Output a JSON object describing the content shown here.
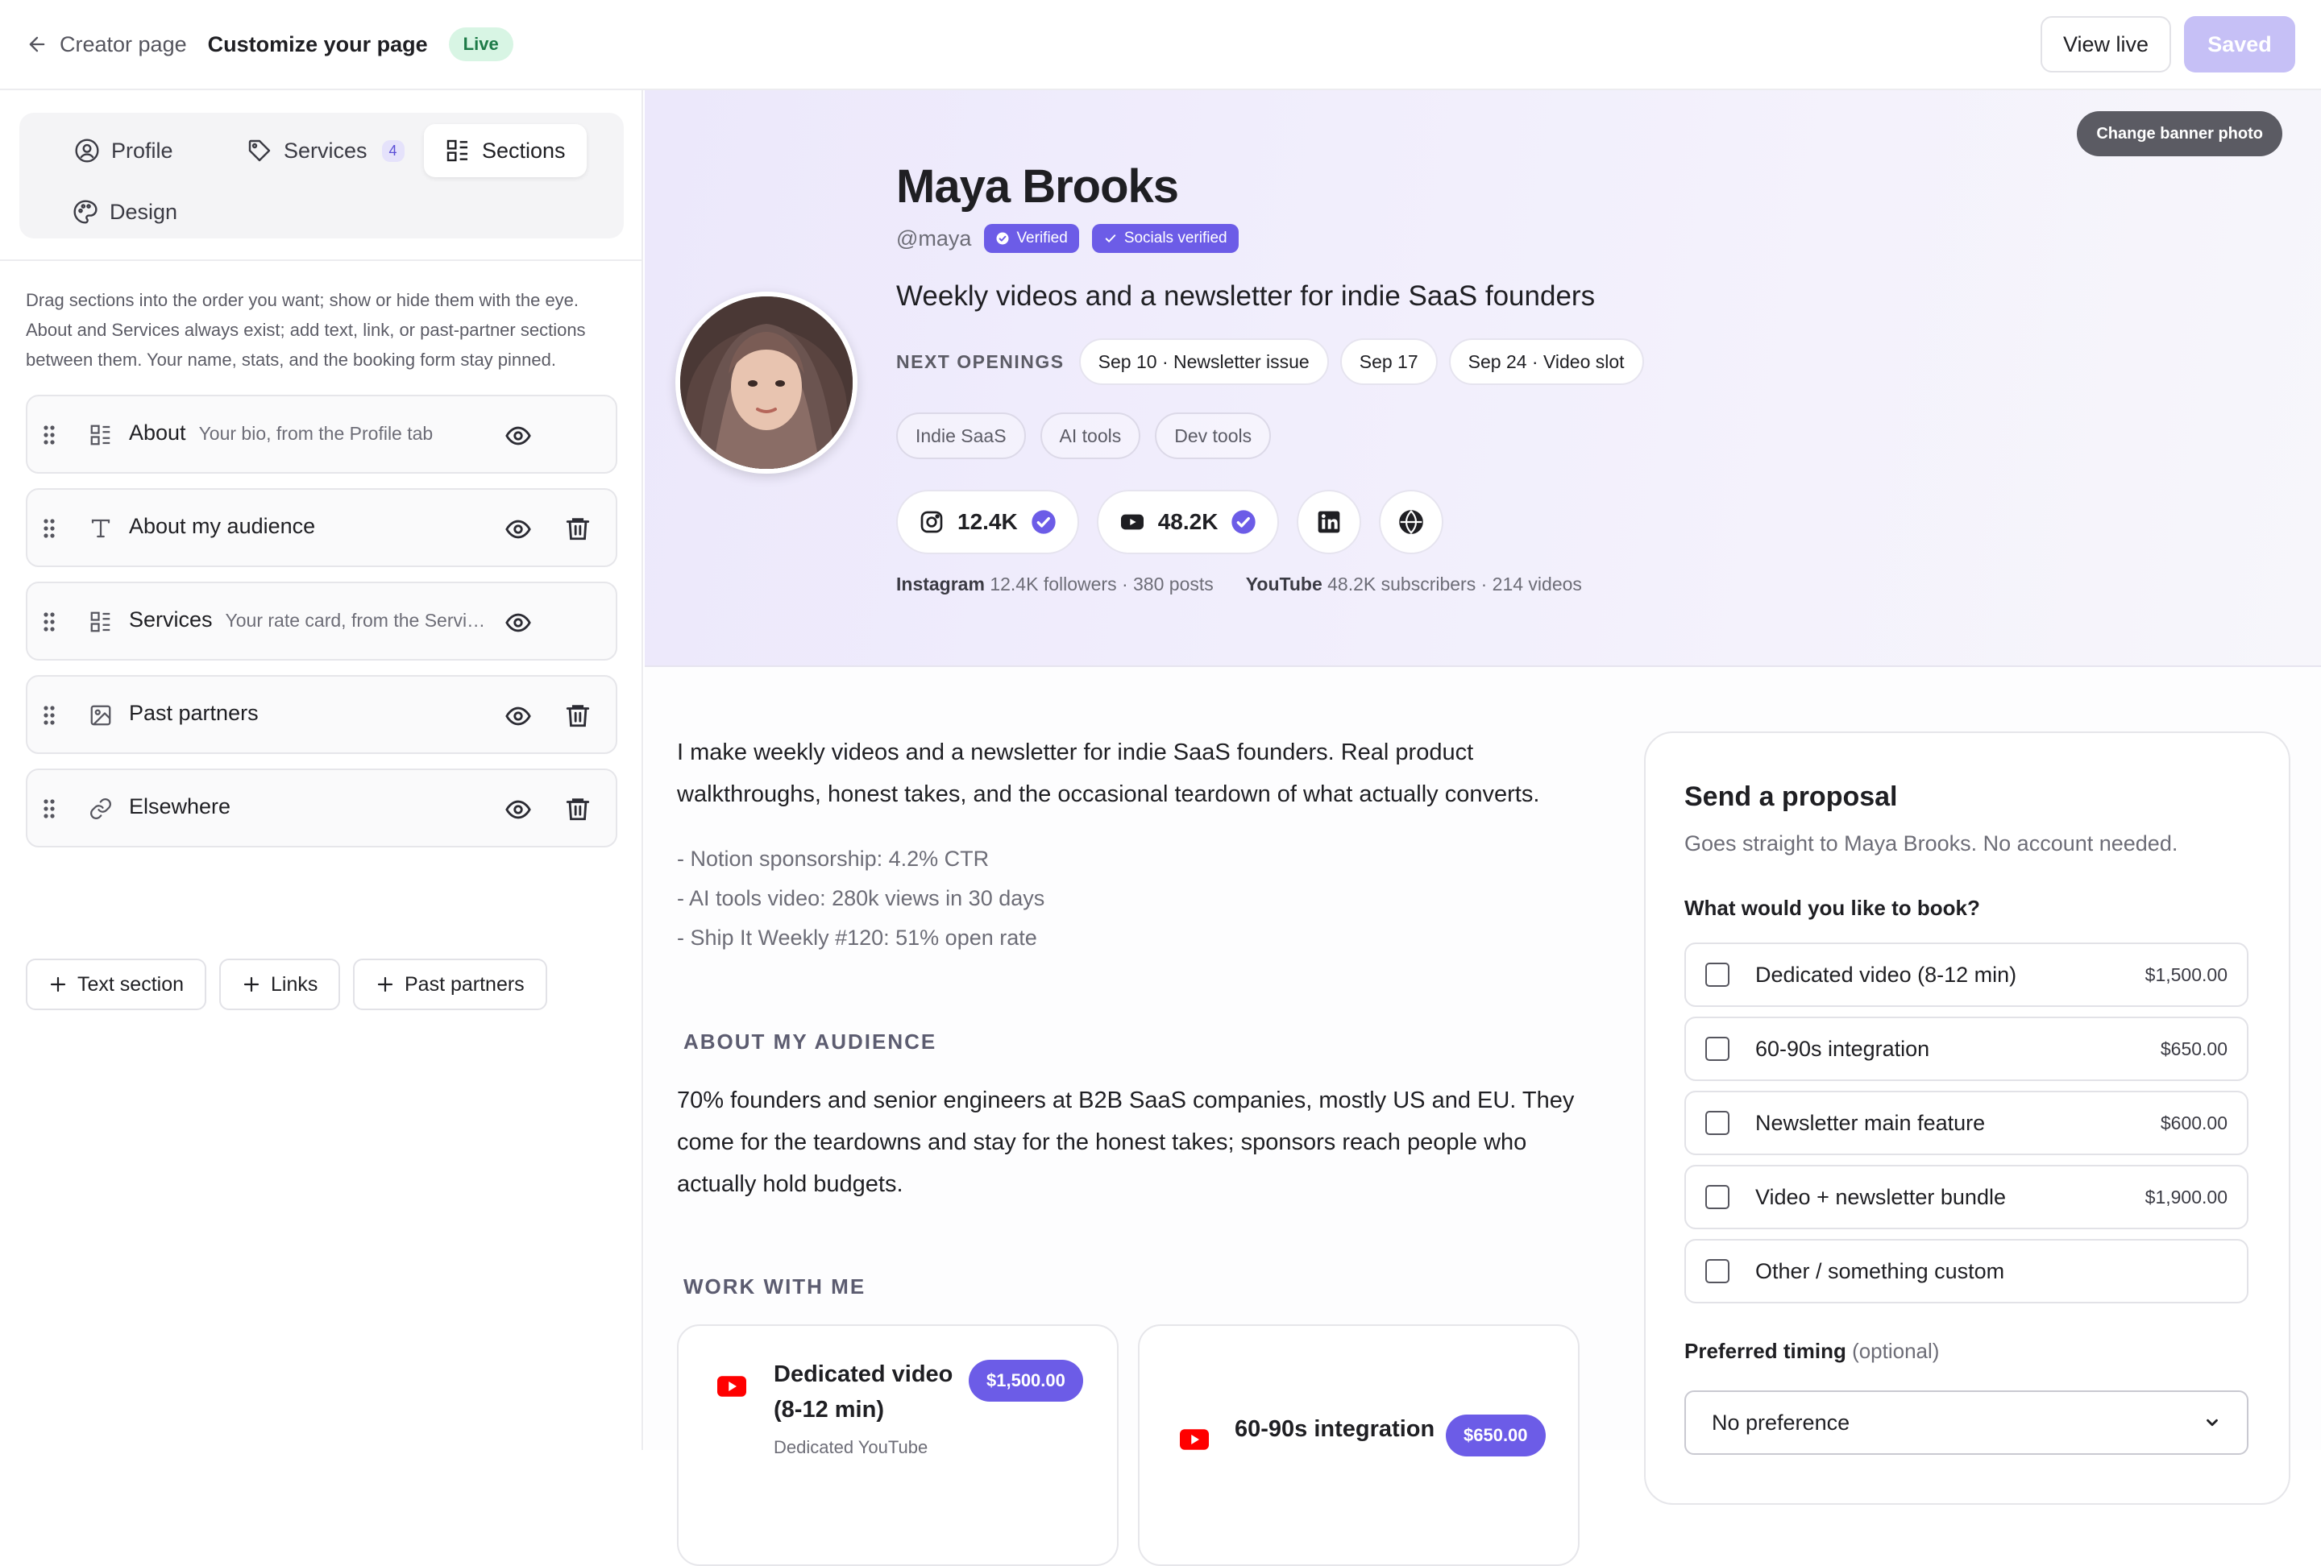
{
  "topbar": {
    "back_label": "Creator page",
    "title": "Customize your page",
    "status": "Live",
    "view_live": "View live",
    "saved": "Saved"
  },
  "sidebar": {
    "tabs": [
      {
        "label": "Profile",
        "icon": "user-circle-icon"
      },
      {
        "label": "Services",
        "icon": "tag-icon",
        "count": "4"
      },
      {
        "label": "Sections",
        "icon": "layout-list-icon",
        "active": true
      },
      {
        "label": "Design",
        "icon": "palette-icon"
      }
    ],
    "help_text": "Drag sections into the order you want; show or hide them with the eye. About and Services always exist; add text, link, or past-partner sections between them. Your name, stats, and the booking form stay pinned.",
    "sections": [
      {
        "title": "About",
        "sub": "Your bio, from the Profile tab",
        "icon": "layout-list-icon",
        "deletable": false
      },
      {
        "title": "About my audience",
        "sub": "",
        "icon": "text-icon",
        "deletable": true
      },
      {
        "title": "Services",
        "sub": "Your rate card, from the Servi…",
        "icon": "layout-list-icon",
        "deletable": false
      },
      {
        "title": "Past partners",
        "sub": "",
        "icon": "image-icon",
        "deletable": true
      },
      {
        "title": "Elsewhere",
        "sub": "",
        "icon": "link-icon",
        "deletable": true
      }
    ],
    "add_buttons": [
      "Text section",
      "Links",
      "Past partners"
    ]
  },
  "banner": {
    "change_banner": "Change banner photo",
    "name": "Maya Brooks",
    "handle": "@maya",
    "badges": [
      "Verified",
      "Socials verified"
    ],
    "tagline": "Weekly videos and a newsletter for indie SaaS founders",
    "openings_label": "NEXT OPENINGS",
    "openings": [
      "Sep 10 · Newsletter issue",
      "Sep 17",
      "Sep 24 · Video slot"
    ],
    "tags": [
      "Indie SaaS",
      "AI tools",
      "Dev tools"
    ],
    "socials": [
      {
        "platform": "instagram-icon",
        "count": "12.4K",
        "verified": true
      },
      {
        "platform": "youtube-icon",
        "count": "48.2K",
        "verified": true
      },
      {
        "platform": "linkedin-icon"
      },
      {
        "platform": "globe-icon"
      }
    ],
    "stats": [
      {
        "platform": "Instagram",
        "detail": "12.4K followers · 380 posts"
      },
      {
        "platform": "YouTube",
        "detail": "48.2K subscribers · 214 videos"
      }
    ]
  },
  "content": {
    "about": "I make weekly videos and a newsletter for indie SaaS founders. Real product walkthroughs, honest takes, and the occasional teardown of what actually converts.",
    "bullets": [
      "- Notion sponsorship: 4.2% CTR",
      "- AI tools video: 280k views in 30 days",
      "- Ship It Weekly #120: 51% open rate"
    ],
    "audience_title": "ABOUT MY AUDIENCE",
    "audience": "70% founders and senior engineers at B2B SaaS companies, mostly US and EU. They come for the teardowns and stay for the honest takes; sponsors reach people who actually hold budgets.",
    "work_title": "WORK WITH ME",
    "cards": [
      {
        "title": "Dedicated video (8-12 min)",
        "sub": "Dedicated YouTube",
        "price": "$1,500.00"
      },
      {
        "title": "60-90s integration",
        "sub": "",
        "price": "$650.00"
      }
    ]
  },
  "proposal": {
    "title": "Send a proposal",
    "subtitle": "Goes straight to Maya Brooks. No account needed.",
    "question": "What would you like to book?",
    "options": [
      {
        "label": "Dedicated video (8-12 min)",
        "price": "$1,500.00"
      },
      {
        "label": "60-90s integration",
        "price": "$650.00"
      },
      {
        "label": "Newsletter main feature",
        "price": "$600.00"
      },
      {
        "label": "Video + newsletter bundle",
        "price": "$1,900.00"
      },
      {
        "label": "Other / something custom",
        "price": ""
      }
    ],
    "timing_label": "Preferred timing",
    "timing_optional": "(optional)",
    "timing_value": "No preference"
  },
  "colors": {
    "accent": "#6c5ce7",
    "live_bg": "#d8f5e4",
    "saved_bg": "#c6c0f6",
    "youtube_red": "#ff0000"
  }
}
